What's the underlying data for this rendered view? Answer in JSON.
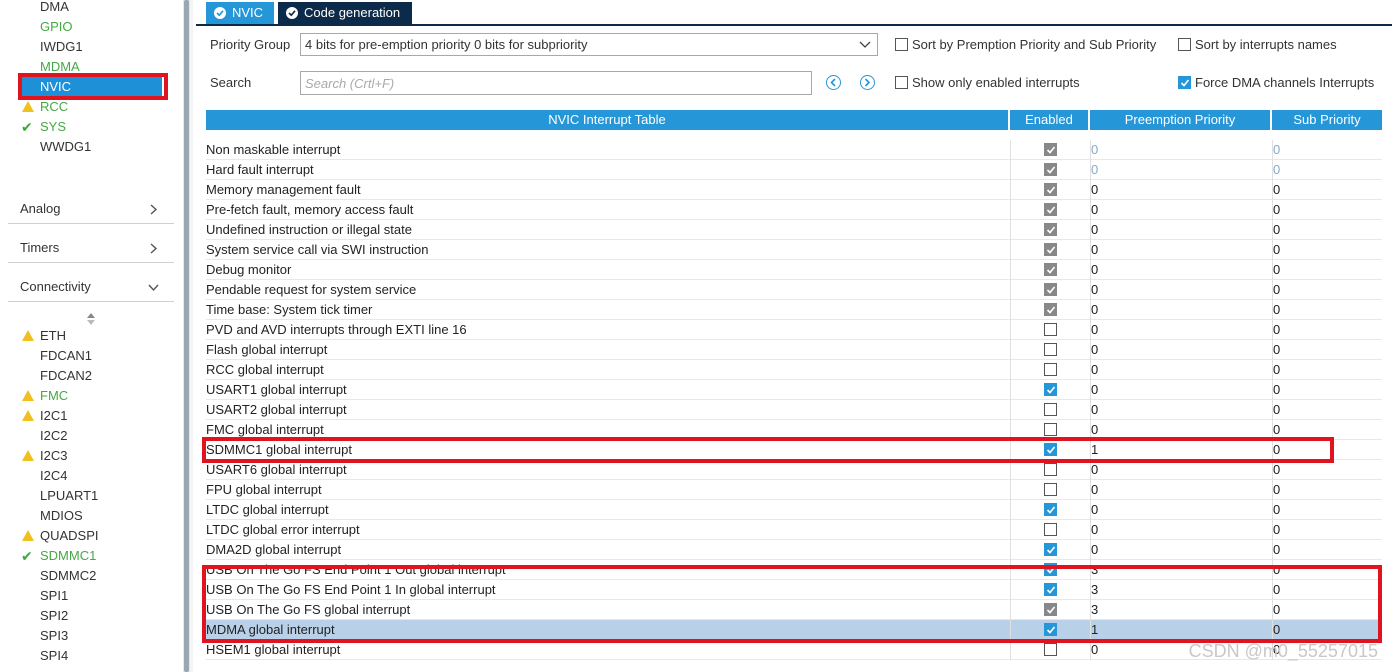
{
  "sidebar": {
    "top_items": [
      {
        "label": "DMA",
        "status": "none",
        "color": "dark"
      },
      {
        "label": "GPIO",
        "status": "none",
        "color": "green"
      },
      {
        "label": "IWDG1",
        "status": "none",
        "color": "dark"
      },
      {
        "label": "MDMA",
        "status": "none",
        "color": "green"
      },
      {
        "label": "NVIC",
        "status": "selected",
        "color": "selected"
      },
      {
        "label": "RCC",
        "status": "warning",
        "color": "green"
      },
      {
        "label": "SYS",
        "status": "check",
        "color": "green"
      },
      {
        "label": "WWDG1",
        "status": "none",
        "color": "dark"
      }
    ],
    "categories": {
      "analog": "Analog",
      "timers": "Timers",
      "connectivity": "Connectivity"
    },
    "connectivity_items": [
      {
        "label": "ETH",
        "status": "warning",
        "color": "dark"
      },
      {
        "label": "FDCAN1",
        "status": "none",
        "color": "dark"
      },
      {
        "label": "FDCAN2",
        "status": "none",
        "color": "dark"
      },
      {
        "label": "FMC",
        "status": "warning",
        "color": "green"
      },
      {
        "label": "I2C1",
        "status": "warning",
        "color": "dark"
      },
      {
        "label": "I2C2",
        "status": "none",
        "color": "dark"
      },
      {
        "label": "I2C3",
        "status": "warning",
        "color": "dark"
      },
      {
        "label": "I2C4",
        "status": "none",
        "color": "dark"
      },
      {
        "label": "LPUART1",
        "status": "none",
        "color": "dark"
      },
      {
        "label": "MDIOS",
        "status": "none",
        "color": "dark"
      },
      {
        "label": "QUADSPI",
        "status": "warning",
        "color": "dark"
      },
      {
        "label": "SDMMC1",
        "status": "check",
        "color": "green"
      },
      {
        "label": "SDMMC2",
        "status": "none",
        "color": "dark"
      },
      {
        "label": "SPI1",
        "status": "none",
        "color": "dark"
      },
      {
        "label": "SPI2",
        "status": "none",
        "color": "dark"
      },
      {
        "label": "SPI3",
        "status": "none",
        "color": "dark"
      },
      {
        "label": "SPI4",
        "status": "none",
        "color": "dark"
      }
    ]
  },
  "tabs": {
    "nvic": "NVIC",
    "code_generation": "Code generation"
  },
  "controls": {
    "priority_group_label": "Priority Group",
    "priority_group_value": "4 bits for pre-emption priority 0 bits for subpriority",
    "search_label": "Search",
    "search_placeholder": "Search (Crtl+F)",
    "sort_by_priority": {
      "label": "Sort by Premption Priority and Sub Priority",
      "checked": false
    },
    "sort_by_names": {
      "label": "Sort by interrupts names",
      "checked": false
    },
    "show_only_enabled": {
      "label": "Show only enabled interrupts",
      "checked": false
    },
    "force_dma": {
      "label": "Force DMA channels Interrupts",
      "checked": true
    }
  },
  "table": {
    "headers": {
      "name": "NVIC Interrupt Table",
      "enabled": "Enabled",
      "preemption": "Preemption Priority",
      "sub": "Sub Priority"
    },
    "rows": [
      {
        "name": "Non maskable interrupt",
        "enabled": "locked",
        "pre": "0",
        "sub": "0",
        "dim": true
      },
      {
        "name": "Hard fault interrupt",
        "enabled": "locked",
        "pre": "0",
        "sub": "0",
        "dim": true
      },
      {
        "name": "Memory management fault",
        "enabled": "locked",
        "pre": "0",
        "sub": "0",
        "dim": false
      },
      {
        "name": "Pre-fetch fault, memory access fault",
        "enabled": "locked",
        "pre": "0",
        "sub": "0",
        "dim": false
      },
      {
        "name": "Undefined instruction or illegal state",
        "enabled": "locked",
        "pre": "0",
        "sub": "0",
        "dim": false
      },
      {
        "name": "System service call via SWI instruction",
        "enabled": "locked",
        "pre": "0",
        "sub": "0",
        "dim": false
      },
      {
        "name": "Debug monitor",
        "enabled": "locked",
        "pre": "0",
        "sub": "0",
        "dim": false
      },
      {
        "name": "Pendable request for system service",
        "enabled": "locked",
        "pre": "0",
        "sub": "0",
        "dim": false
      },
      {
        "name": "Time base: System tick timer",
        "enabled": "locked",
        "pre": "0",
        "sub": "0",
        "dim": false
      },
      {
        "name": "PVD and AVD interrupts through EXTI line 16",
        "enabled": "off",
        "pre": "0",
        "sub": "0",
        "dim": false
      },
      {
        "name": "Flash global interrupt",
        "enabled": "off",
        "pre": "0",
        "sub": "0",
        "dim": false
      },
      {
        "name": "RCC global interrupt",
        "enabled": "off",
        "pre": "0",
        "sub": "0",
        "dim": false
      },
      {
        "name": "USART1 global interrupt",
        "enabled": "on",
        "pre": "0",
        "sub": "0",
        "dim": false
      },
      {
        "name": "USART2 global interrupt",
        "enabled": "off",
        "pre": "0",
        "sub": "0",
        "dim": false
      },
      {
        "name": "FMC global interrupt",
        "enabled": "off",
        "pre": "0",
        "sub": "0",
        "dim": false
      },
      {
        "name": "SDMMC1 global interrupt",
        "enabled": "on",
        "pre": "1",
        "sub": "0",
        "dim": false
      },
      {
        "name": "USART6 global interrupt",
        "enabled": "off",
        "pre": "0",
        "sub": "0",
        "dim": false
      },
      {
        "name": "FPU global interrupt",
        "enabled": "off",
        "pre": "0",
        "sub": "0",
        "dim": false
      },
      {
        "name": "LTDC global interrupt",
        "enabled": "on",
        "pre": "0",
        "sub": "0",
        "dim": false
      },
      {
        "name": "LTDC global error interrupt",
        "enabled": "off",
        "pre": "0",
        "sub": "0",
        "dim": false
      },
      {
        "name": "DMA2D global interrupt",
        "enabled": "on",
        "pre": "0",
        "sub": "0",
        "dim": false
      },
      {
        "name": "USB On The Go FS End Point 1 Out global interrupt",
        "enabled": "on",
        "pre": "3",
        "sub": "0",
        "dim": false
      },
      {
        "name": "USB On The Go FS End Point 1 In global interrupt",
        "enabled": "on",
        "pre": "3",
        "sub": "0",
        "dim": false
      },
      {
        "name": "USB On The Go FS global interrupt",
        "enabled": "locked",
        "pre": "3",
        "sub": "0",
        "dim": false
      },
      {
        "name": "MDMA global interrupt",
        "enabled": "on",
        "pre": "1",
        "sub": "0",
        "dim": false,
        "selected": true
      },
      {
        "name": "HSEM1 global interrupt",
        "enabled": "off",
        "pre": "0",
        "sub": "0",
        "dim": false
      }
    ]
  },
  "watermark": "CSDN @m0_55257015",
  "colors": {
    "accent": "#2596d8",
    "dark_tab": "#0c2a4a",
    "annotation_red": "#e0141e",
    "ok_green": "#45a845",
    "warn_yellow": "#f0c020"
  }
}
